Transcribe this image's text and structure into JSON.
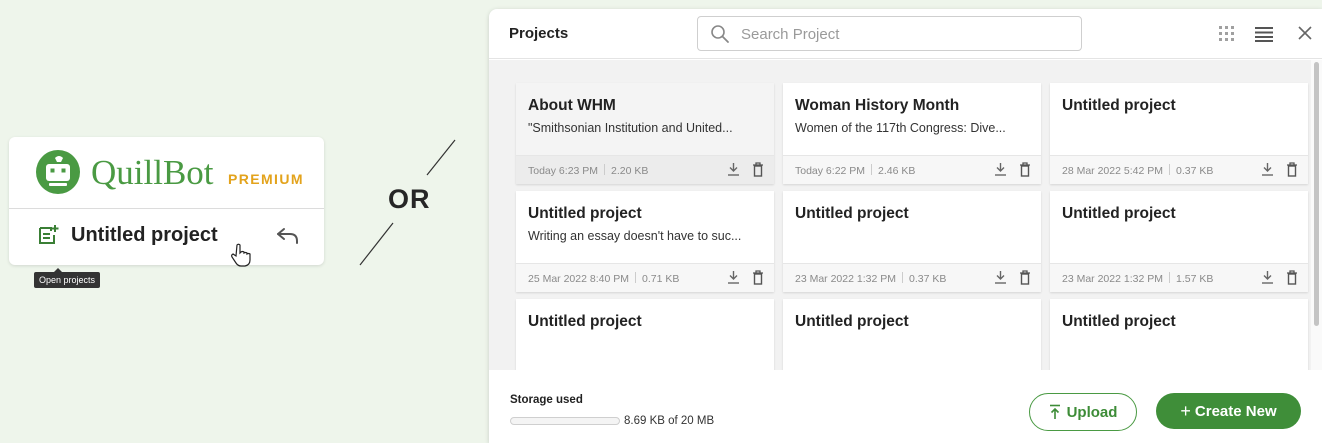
{
  "quillbot_card": {
    "brand_name": "QuillBot",
    "premium_label": "PREMIUM",
    "project_title": "Untitled project",
    "tooltip": "Open projects"
  },
  "separator_text": "OR",
  "projects_dialog": {
    "title": "Projects",
    "search_placeholder": "Search Project",
    "cards": [
      {
        "title": "About WHM",
        "description": "\"Smithsonian Institution and United...",
        "date": "Today 6:23 PM",
        "size": "2.20 KB"
      },
      {
        "title": "Woman History Month",
        "description": "Women of the 117th Congress: Dive...",
        "date": "Today 6:22 PM",
        "size": "2.46 KB"
      },
      {
        "title": "Untitled project",
        "description": "",
        "date": "28 Mar 2022 5:42 PM",
        "size": "0.37 KB"
      },
      {
        "title": "Untitled project",
        "description": "Writing an essay doesn't have to suc...",
        "date": "25 Mar 2022 8:40 PM",
        "size": "0.71 KB"
      },
      {
        "title": "Untitled project",
        "description": "",
        "date": "23 Mar 2022 1:32 PM",
        "size": "0.37 KB"
      },
      {
        "title": "Untitled project",
        "description": "",
        "date": "23 Mar 2022 1:32 PM",
        "size": "1.57 KB"
      },
      {
        "title": "Untitled project",
        "description": "",
        "date": "",
        "size": ""
      },
      {
        "title": "Untitled project",
        "description": "",
        "date": "",
        "size": ""
      },
      {
        "title": "Untitled project",
        "description": "",
        "date": "",
        "size": ""
      }
    ],
    "storage": {
      "label": "Storage used",
      "text": "8.69 KB of 20 MB",
      "used_fraction": 0.0004
    },
    "upload_label": "Upload",
    "create_label": "Create New"
  },
  "colors": {
    "brand_green": "#4a9a43",
    "premium_gold": "#e3a31c",
    "background": "#eef5eb"
  }
}
